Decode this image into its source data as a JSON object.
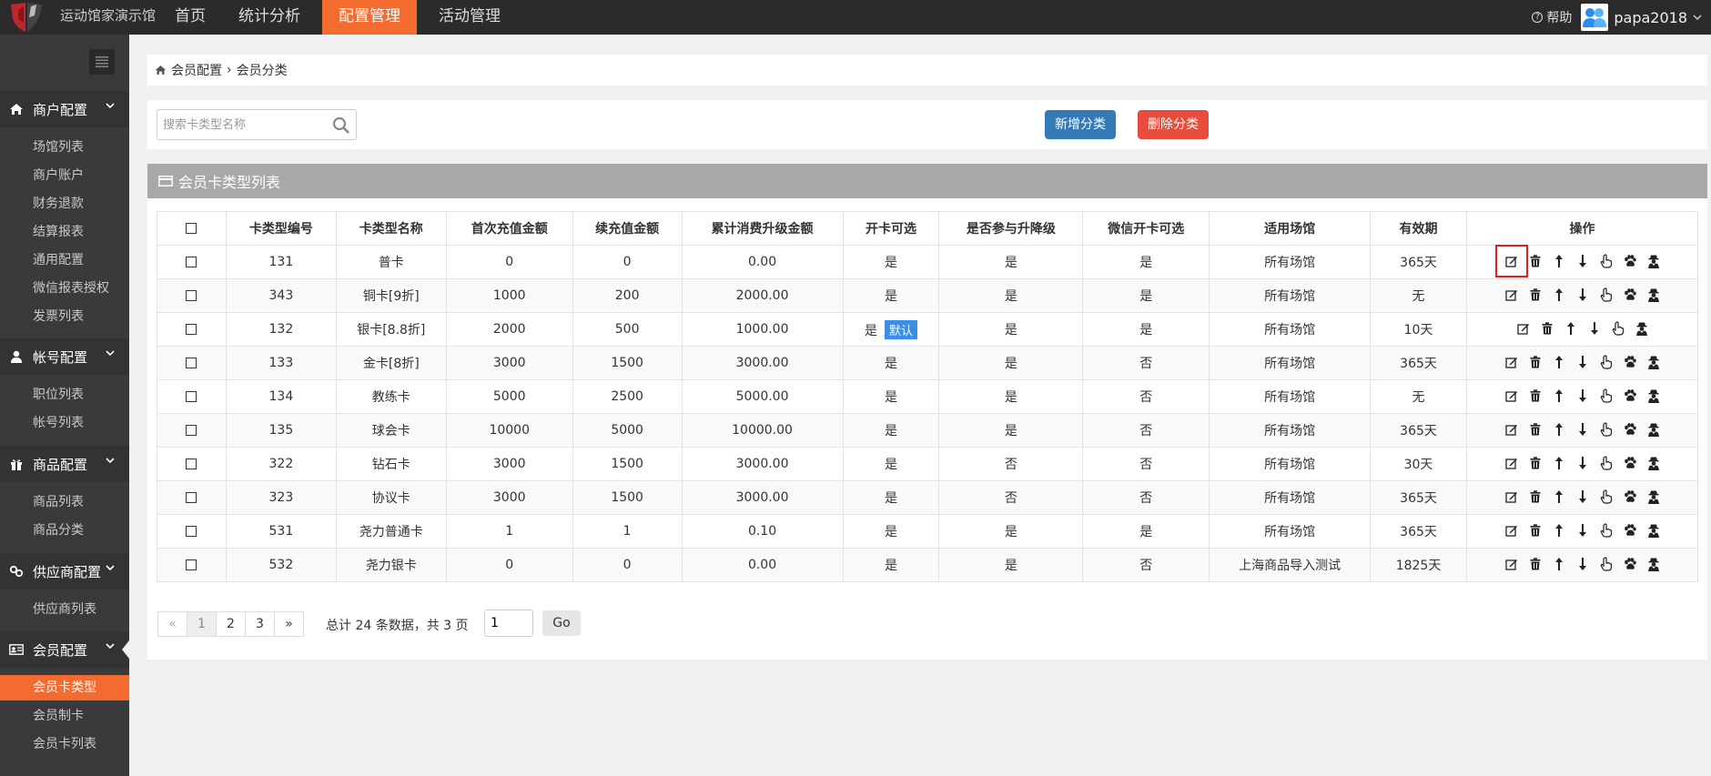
{
  "app": {
    "brand": "运动馆家演示馆"
  },
  "topnav": {
    "items": [
      {
        "label": "首页"
      },
      {
        "label": "统计分析"
      },
      {
        "label": "配置管理"
      },
      {
        "label": "活动管理"
      }
    ],
    "help_label": "帮助",
    "username": "papa2018"
  },
  "sidebar": {
    "groups": [
      {
        "label": "商户配置",
        "icon": "home-icon",
        "items": [
          "场馆列表",
          "商户账户",
          "财务退款",
          "结算报表",
          "通用配置",
          "微信报表授权",
          "发票列表"
        ]
      },
      {
        "label": "帐号配置",
        "icon": "user-icon",
        "items": [
          "职位列表",
          "帐号列表"
        ]
      },
      {
        "label": "商品配置",
        "icon": "gift-icon",
        "items": [
          "商品列表",
          "商品分类"
        ]
      },
      {
        "label": "供应商配置",
        "icon": "link-icon",
        "items": [
          "供应商列表"
        ]
      },
      {
        "label": "会员配置",
        "icon": "id-card-icon",
        "items": [
          "会员卡类型",
          "会员制卡",
          "会员卡列表"
        ]
      }
    ],
    "active_item": "会员卡类型"
  },
  "breadcrumb": {
    "parent": "会员配置",
    "current": "会员分类"
  },
  "toolbar": {
    "search_placeholder": "搜索卡类型名称",
    "add_label": "新增分类",
    "delete_label": "删除分类"
  },
  "list": {
    "title": "会员卡类型列表",
    "columns": [
      "卡类型编号",
      "卡类型名称",
      "首次充值金额",
      "续充值金额",
      "累计消费升级金额",
      "开卡可选",
      "是否参与升降级",
      "微信开卡可选",
      "适用场馆",
      "有效期",
      "操作"
    ],
    "rows": [
      {
        "id": "131",
        "name": "普卡",
        "first": "0",
        "renew": "0",
        "upgrade": "0.00",
        "open": "是",
        "default": "",
        "levels": "是",
        "wechat": "是",
        "venue": "所有场馆",
        "validity": "365天"
      },
      {
        "id": "343",
        "name": "铜卡[9折]",
        "first": "1000",
        "renew": "200",
        "upgrade": "2000.00",
        "open": "是",
        "default": "",
        "levels": "是",
        "wechat": "是",
        "venue": "所有场馆",
        "validity": "无"
      },
      {
        "id": "132",
        "name": "银卡[8.8折]",
        "first": "2000",
        "renew": "500",
        "upgrade": "1000.00",
        "open": "是",
        "default": "默认",
        "levels": "是",
        "wechat": "是",
        "venue": "所有场馆",
        "validity": "10天"
      },
      {
        "id": "133",
        "name": "金卡[8折]",
        "first": "3000",
        "renew": "1500",
        "upgrade": "3000.00",
        "open": "是",
        "default": "",
        "levels": "是",
        "wechat": "否",
        "venue": "所有场馆",
        "validity": "365天"
      },
      {
        "id": "134",
        "name": "教练卡",
        "first": "5000",
        "renew": "2500",
        "upgrade": "5000.00",
        "open": "是",
        "default": "",
        "levels": "是",
        "wechat": "否",
        "venue": "所有场馆",
        "validity": "无"
      },
      {
        "id": "135",
        "name": "球会卡",
        "first": "10000",
        "renew": "5000",
        "upgrade": "10000.00",
        "open": "是",
        "default": "",
        "levels": "是",
        "wechat": "否",
        "venue": "所有场馆",
        "validity": "365天"
      },
      {
        "id": "322",
        "name": "钻石卡",
        "first": "3000",
        "renew": "1500",
        "upgrade": "3000.00",
        "open": "是",
        "default": "",
        "levels": "否",
        "wechat": "否",
        "venue": "所有场馆",
        "validity": "30天"
      },
      {
        "id": "323",
        "name": "协议卡",
        "first": "3000",
        "renew": "1500",
        "upgrade": "3000.00",
        "open": "是",
        "default": "",
        "levels": "否",
        "wechat": "否",
        "venue": "所有场馆",
        "validity": "365天"
      },
      {
        "id": "531",
        "name": "尧力普通卡",
        "first": "1",
        "renew": "1",
        "upgrade": "0.10",
        "open": "是",
        "default": "",
        "levels": "是",
        "wechat": "是",
        "venue": "所有场馆",
        "validity": "365天"
      },
      {
        "id": "532",
        "name": "尧力银卡",
        "first": "0",
        "renew": "0",
        "upgrade": "0.00",
        "open": "是",
        "default": "",
        "levels": "是",
        "wechat": "否",
        "venue": "上海商品导入测试",
        "validity": "1825天"
      }
    ]
  },
  "pagination": {
    "prev": "«",
    "pages": [
      "1",
      "2",
      "3"
    ],
    "next": "»",
    "current_page": "1",
    "summary": "总计 24 条数据，共 3 页",
    "input_value": "1",
    "go_label": "Go"
  },
  "colors": {
    "topbar": "#2b2b2b",
    "accent": "#f36b2f",
    "sidebar": "#3a3a3a",
    "primary_button": "#337ab7",
    "danger_button": "#e74c3c",
    "list_header": "#a8a8a8",
    "highlight": "#e02020"
  }
}
